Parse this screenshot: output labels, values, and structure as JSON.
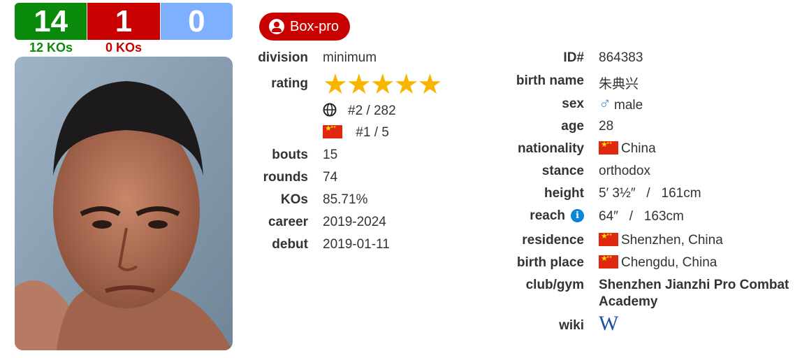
{
  "record": {
    "wins": "14",
    "losses": "1",
    "draws": "0",
    "wins_kos": "12 KOs",
    "losses_kos": "0 KOs"
  },
  "badge": {
    "label": "Box-pro"
  },
  "left": {
    "division_label": "division",
    "division": "minimum",
    "rating_label": "rating",
    "rating_stars": 4.5,
    "world_rank": "#2 / 282",
    "country_rank": "#1 / 5",
    "bouts_label": "bouts",
    "bouts": "15",
    "rounds_label": "rounds",
    "rounds": "74",
    "kos_label": "KOs",
    "kos": "85.71%",
    "career_label": "career",
    "career": "2019-2024",
    "debut_label": "debut",
    "debut": "2019-01-11"
  },
  "right": {
    "id_label": "ID#",
    "id": "864383",
    "birthname_label": "birth name",
    "birthname": "朱典兴",
    "sex_label": "sex",
    "sex": "male",
    "age_label": "age",
    "age": "28",
    "nationality_label": "nationality",
    "nationality": "China",
    "stance_label": "stance",
    "stance": "orthodox",
    "height_label": "height",
    "height": "5′ 3½″   /   161cm",
    "reach_label": "reach",
    "reach": "64″   /   163cm",
    "residence_label": "residence",
    "residence": "Shenzhen, China",
    "birthplace_label": "birth place",
    "birthplace": "Chengdu, China",
    "club_label": "club/gym",
    "club": "Shenzhen Jianzhi Pro Combat Academy",
    "wiki_label": "wiki",
    "wiki": "W"
  },
  "colors": {
    "win": "#0a8a0a",
    "loss": "#c80000",
    "draw": "#7fb0ff",
    "star": "#f7b500",
    "info": "#0a84d6"
  },
  "icons": {
    "user": "user-circle-icon",
    "globe": "globe-icon",
    "flag": "china-flag-icon",
    "sex": "male-symbol-icon",
    "info": "info-icon",
    "wiki": "wikipedia-icon"
  }
}
